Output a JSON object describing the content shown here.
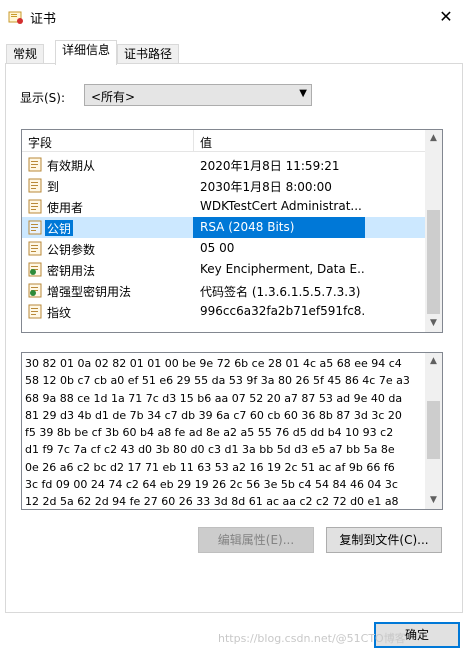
{
  "window": {
    "title": "证书",
    "close_glyph": "✕"
  },
  "tabs": [
    {
      "label": "常规",
      "active": false
    },
    {
      "label": "详细信息",
      "active": true
    },
    {
      "label": "证书路径",
      "active": false
    }
  ],
  "show": {
    "label": "显示(S):",
    "selected": "<所有>"
  },
  "fields_list": {
    "header_field": "字段",
    "header_value": "值",
    "rows": [
      {
        "name": "有效期从",
        "value": "2020年1月8日 11:59:21",
        "icon": "certificate-field-icon"
      },
      {
        "name": "到",
        "value": "2030年1月8日 8:00:00",
        "icon": "certificate-field-icon"
      },
      {
        "name": "使用者",
        "value": "WDKTestCert Administrat...",
        "icon": "certificate-field-icon"
      },
      {
        "name": "公钥",
        "value": "RSA (2048 Bits)",
        "icon": "certificate-field-icon",
        "selected": true
      },
      {
        "name": "公钥参数",
        "value": "05 00",
        "icon": "certificate-field-icon"
      },
      {
        "name": "密钥用法",
        "value": "Key Encipherment, Data E...",
        "icon": "extension-icon"
      },
      {
        "name": "增强型密钥用法",
        "value": "代码签名 (1.3.6.1.5.5.7.3.3)",
        "icon": "extension-icon"
      },
      {
        "name": "指纹",
        "value": "996cc6a32fa2b71ef591fc8...",
        "icon": "certificate-field-icon"
      }
    ]
  },
  "detail": {
    "lines": [
      "30 82 01 0a 02 82 01 01 00 be 9e 72 6b ce 28 01 4c a5 68 ee 94 c4",
      "58 12 0b c7 cb a0 ef 51 e6 29 55 da 53 9f 3a 80 26 5f 45 86 4c 7e a3",
      "68 9a 88 ce 1d 1a 71 7c d3 15 b6 aa 07 52 20 a7 87 53 ad 9e 40 da",
      "81 29 d3 4b d1 de 7b 34 c7 db 39 6a c7 60 cb 60 36 8b 87 3d 3c 20",
      "f5 39 8b be cf 3b 60 b4 a8 fe ad 8e a2 a5 55 76 d5 dd b4 10 93 c2",
      "d1 f9 7c 7a cf c2 43 d0 3b 80 d0 c3 d1 3a bb 5d d3 e5 a7 bb 5a 8e",
      "0e 26 a6 c2 bc d2 17 71 eb 11 63 53 a2 16 19 2c 51 ac af 9b 66 f6",
      "3c fd 09 00 24 74 c2 64 eb 29 19 26 2c 56 3e 5b c4 54 84 46 04 3c",
      "12 2d 5a 62 2d 94 fe 27 60 26 33 3d 8d 61 ac aa c2 c2 72 d0 e1 a8"
    ]
  },
  "buttons": {
    "edit_properties": "编辑属性(E)...",
    "copy_to_file": "复制到文件(C)...",
    "ok": "确定"
  },
  "watermark": "https://blog.csdn.net/@51CTO博客",
  "colors": {
    "selection": "#0078d7",
    "default_border": "#0078d7"
  }
}
